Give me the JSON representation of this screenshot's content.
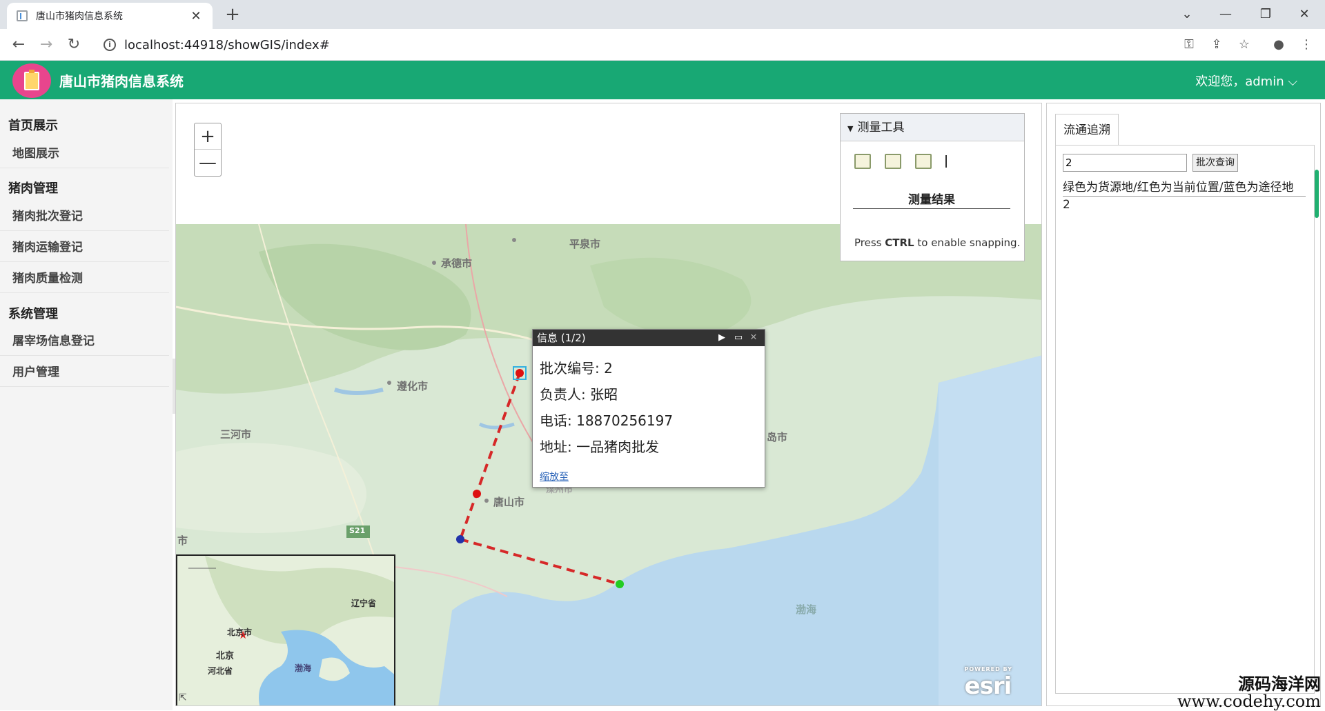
{
  "browser": {
    "tab_title": "唐山市猪肉信息系统",
    "url": "localhost:44918/showGIS/index#"
  },
  "header": {
    "app_name": "唐山市猪肉信息系统",
    "welcome": "欢迎您，admin"
  },
  "sidebar": {
    "groups": [
      {
        "title": "首页展示",
        "items": [
          "地图展示"
        ]
      },
      {
        "title": "猪肉管理",
        "items": [
          "猪肉批次登记",
          "猪肉运输登记",
          "猪肉质量检测"
        ]
      },
      {
        "title": "系统管理",
        "items": [
          "屠宰场信息登记",
          "用户管理"
        ]
      }
    ]
  },
  "map": {
    "zoom_in": "+",
    "zoom_out": "—",
    "labels": [
      "平泉市",
      "承德市",
      "遵化市",
      "三河市",
      "唐山市",
      "岛市",
      "渤海",
      "S21",
      "市",
      "滦州市"
    ],
    "overview_labels": [
      "辽宁省",
      "北京市",
      "北京",
      "河北省",
      "渤海"
    ],
    "esri": "esri",
    "esri_tag": "POWERED BY",
    "route_colors": {
      "route": "#d62828",
      "origin": "#22cc22",
      "current": "#dd1111",
      "waypoint": "#2233aa"
    }
  },
  "measure": {
    "title": "测量工具",
    "result_title": "测量结果",
    "hint_prefix": "Press ",
    "hint_key": "CTRL",
    "hint_suffix": " to enable snapping."
  },
  "popup": {
    "title": "信息 (1/2)",
    "batch": "批次编号: 2",
    "owner": "负责人: 张昭",
    "phone": "电话: 18870256197",
    "address": "地址: 一品猪肉批发",
    "zoom_link": "缩放至"
  },
  "trace": {
    "tab": "流通追溯",
    "input_value": "2",
    "query_button": "批次查询",
    "legend": "绿色为货源地/红色为当前位置/蓝色为途径地",
    "result": "2"
  },
  "watermark": {
    "line1": "源码海洋网",
    "line2": "www.codehy.com"
  }
}
